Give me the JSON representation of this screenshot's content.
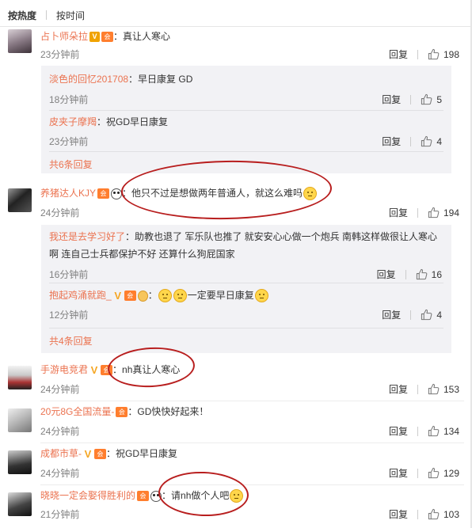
{
  "tabs": {
    "hot": "按热度",
    "time": "按时间"
  },
  "labels": {
    "reply": "回复"
  },
  "comments": [
    {
      "user": "占卜师朵拉",
      "text": "：真让人寒心",
      "time": "23分钟前",
      "likes": "198",
      "subs": [
        {
          "user": "淡色的回忆201708",
          "text": "：早日康复   GD",
          "time": "18分钟前",
          "likes": "5"
        },
        {
          "user": "皮夹子摩羯",
          "text": "：祝GD早日康复",
          "time": "23分钟前",
          "likes": "4"
        }
      ],
      "more": "共6条回复"
    },
    {
      "user": "养猪达人KJY",
      "text": "：他只不过是想做两年普通人，就这么难吗",
      "time": "24分钟前",
      "likes": "194",
      "subs": [
        {
          "user": "我还是去学习好了",
          "text": "：助教也退了 军乐队也推了 就安安心心做一个炮兵 南韩这样做很让人寒心啊 连自己士兵都保护不好 还算什么狗屁国家",
          "time": "16分钟前",
          "likes": "16"
        },
        {
          "user": "抱起鸡涌就跑_",
          "text": "：",
          "text2": "一定要早日康复",
          "time": "12分钟前",
          "likes": "4"
        }
      ],
      "more": "共4条回复"
    },
    {
      "user": "手游电竞君",
      "text": "：nh真让人寒心",
      "time": "24分钟前",
      "likes": "153"
    },
    {
      "user": "20元8G全国流量-",
      "text": "：GD快快好起来！",
      "time": "24分钟前",
      "likes": "134"
    },
    {
      "user": "成都市草-",
      "text": "：祝GD早日康复",
      "time": "24分钟前",
      "likes": "129"
    },
    {
      "user": "晓晓一定会娶得胜利的",
      "text": "：请nh做个人吧",
      "time": "21分钟前",
      "likes": "103"
    }
  ],
  "colors": {
    "username": "#eb7350",
    "annotation": "#b81e1e"
  }
}
